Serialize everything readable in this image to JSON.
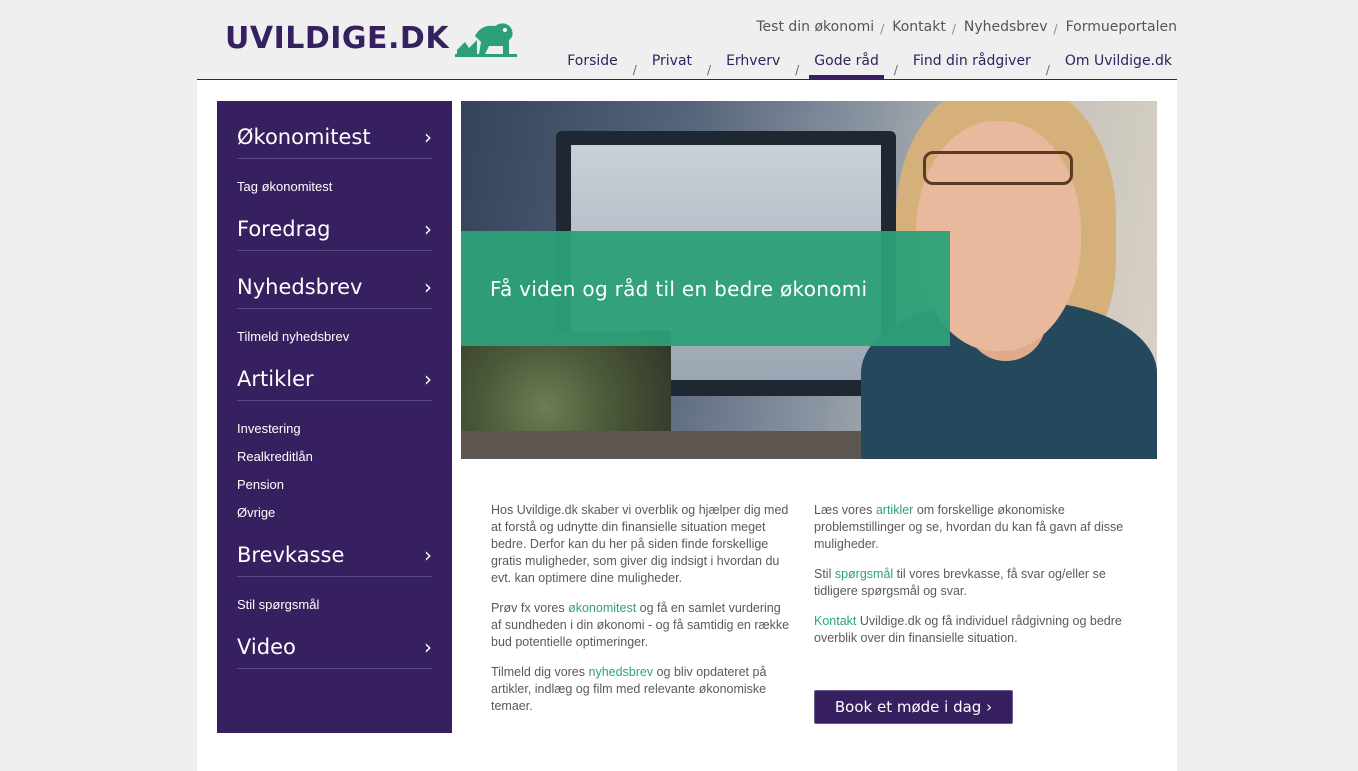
{
  "logo": {
    "text": "UVILDIGE.DK"
  },
  "topnav": {
    "items": [
      {
        "label": "Test din økonomi"
      },
      {
        "label": "Kontakt"
      },
      {
        "label": "Nyhedsbrev"
      },
      {
        "label": "Formueportalen"
      }
    ],
    "separator": "/"
  },
  "mainnav": {
    "items": [
      {
        "label": "Forside"
      },
      {
        "label": "Privat"
      },
      {
        "label": "Erhverv"
      },
      {
        "label": "Gode råd",
        "active": true
      },
      {
        "label": "Find din rådgiver"
      },
      {
        "label": "Om Uvildige.dk"
      }
    ],
    "separator": "/"
  },
  "sidebar": {
    "chevron": "›",
    "sections": [
      {
        "title": "Økonomitest",
        "links": [
          "Tag økonomitest"
        ]
      },
      {
        "title": "Foredrag",
        "links": []
      },
      {
        "title": "Nyhedsbrev",
        "links": [
          "Tilmeld nyhedsbrev"
        ]
      },
      {
        "title": "Artikler",
        "links": [
          "Investering",
          "Realkreditlån",
          "Pension",
          "Øvrige"
        ]
      },
      {
        "title": "Brevkasse",
        "links": [
          "Stil spørgsmål"
        ]
      },
      {
        "title": "Video",
        "links": []
      }
    ]
  },
  "hero": {
    "headline": "Få viden og råd til en bedre økonomi"
  },
  "content": {
    "col1": {
      "p1": "Hos Uvildige.dk skaber vi overblik og hjælper dig med at forstå og udnytte din finansielle situation meget bedre. Derfor kan du her på siden finde forskellige gratis muligheder, som giver dig indsigt i hvordan du evt. kan optimere dine muligheder.",
      "p2_pre": "Prøv fx vores ",
      "p2_link": "økonomitest",
      "p2_post": " og få en samlet vurdering af sundheden i din økonomi - og få samtidig en række bud potentielle optimeringer.",
      "p3_pre": "Tilmeld dig vores ",
      "p3_link": "nyhedsbrev",
      "p3_post": " og bliv opdateret på artikler, indlæg og film med relevante økonomiske temaer."
    },
    "col2": {
      "p1_pre": "Læs vores ",
      "p1_link": "artikler",
      "p1_post": " om forskellige økonomiske problemstillinger og se, hvordan du kan få gavn af disse muligheder.",
      "p2_pre": "Stil ",
      "p2_link": "spørgsmål",
      "p2_post": " til vores brevkasse, få svar og/eller se tidligere spørgsmål og svar.",
      "p3_link": "Kontakt",
      "p3_post": " Uvildige.dk og få individuel rådgivning og bedre overblik over din finansielle situation."
    },
    "cta": "Book et møde i dag ›"
  },
  "colors": {
    "brand_purple": "#36205f",
    "brand_green": "#2ca078"
  },
  "icons": {
    "logo_mark": "lion-icon"
  }
}
